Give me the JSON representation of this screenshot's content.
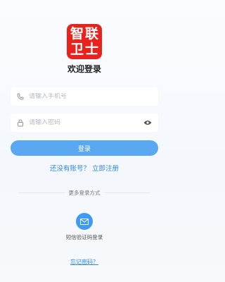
{
  "logo": {
    "chars": [
      "智",
      "联",
      "卫",
      "士"
    ]
  },
  "welcome": "欢迎登录",
  "phone": {
    "placeholder": "请输入手机号",
    "icon": "phone-icon"
  },
  "password": {
    "placeholder": "请输入密码",
    "icon": "lock-icon",
    "toggle_icon": "eye-icon"
  },
  "login_button": "登录",
  "register_link": "还没有账号？ 立即注册",
  "more_methods": "更多登录方式",
  "sms_login": {
    "label": "短信验证码登录",
    "icon": "mail-icon"
  },
  "forgot_password": "忘记密码？",
  "colors": {
    "brand": "#e8231d",
    "primary": "#5aa7f2",
    "link": "#2f86e0"
  }
}
